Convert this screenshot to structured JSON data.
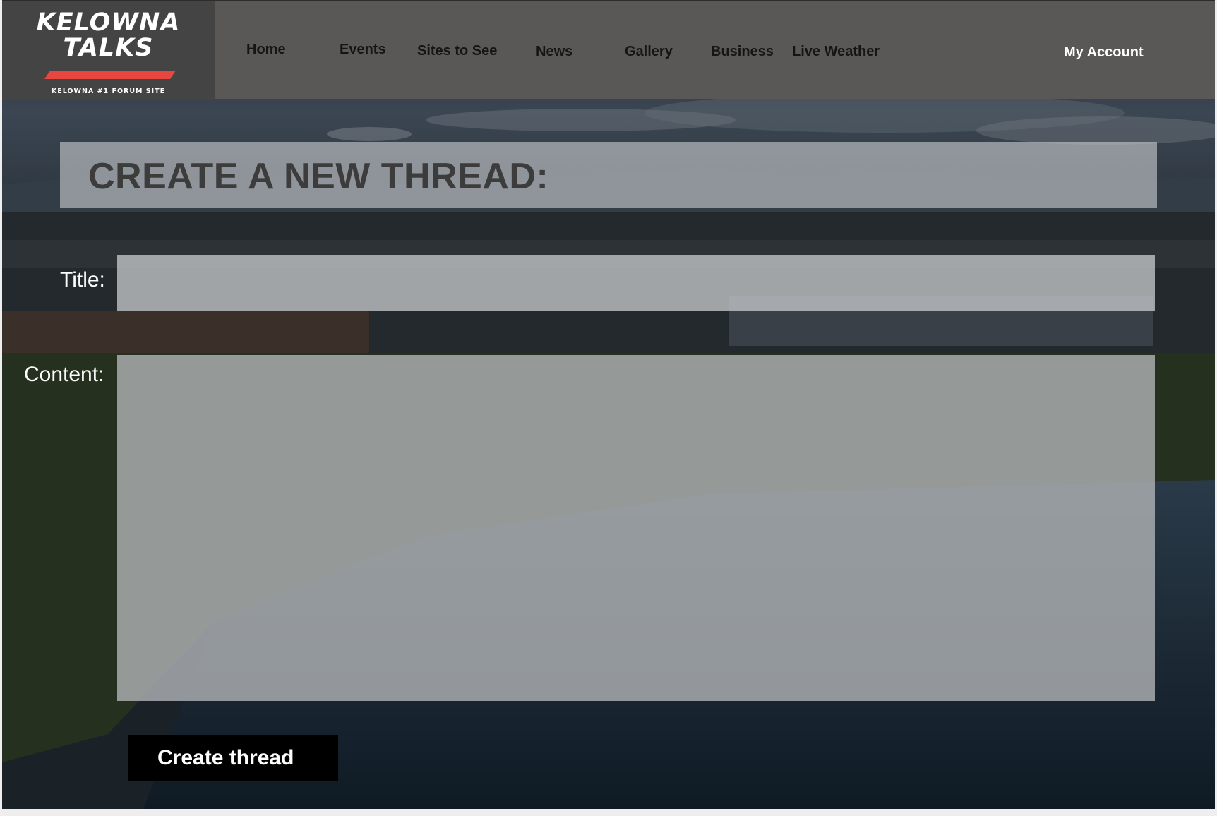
{
  "logo": {
    "line1": "KELOWNA",
    "line2": "TALKS",
    "tagline": "KELOWNA #1 FORUM SITE",
    "accent_color": "#e8463e"
  },
  "nav": {
    "items": [
      {
        "label": "Home"
      },
      {
        "label": "Events"
      },
      {
        "label": "Sites to See"
      },
      {
        "label": "News"
      },
      {
        "label": "Gallery"
      },
      {
        "label": "Business"
      },
      {
        "label": "Live Weather"
      }
    ],
    "account": "My Account"
  },
  "form": {
    "heading": "CREATE A NEW THREAD:",
    "title_label": "Title:",
    "title_value": "",
    "content_label": "Content:",
    "content_value": "",
    "submit_label": "Create thread"
  },
  "colors": {
    "header_bg": "#5a5757",
    "logo_bg": "#454444",
    "button_bg": "#000000"
  }
}
